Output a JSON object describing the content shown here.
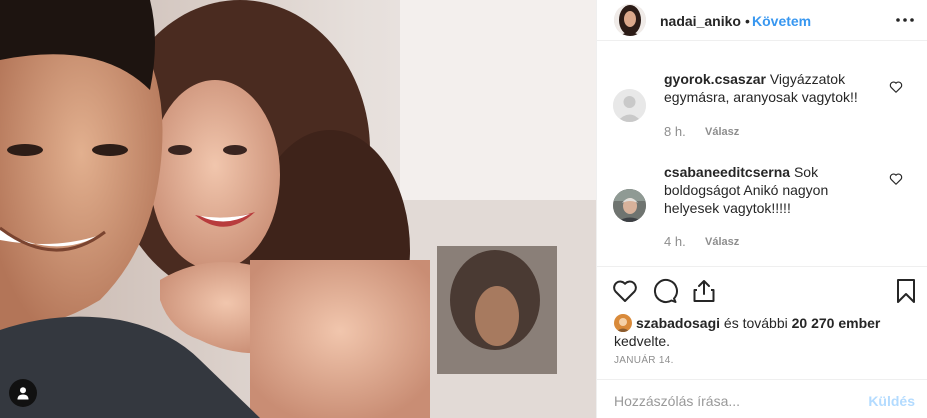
{
  "post": {
    "author": "nadai_aniko",
    "separator": "•",
    "follow_label": "Követem",
    "more_icon": "more-options-icon"
  },
  "comments": [
    {
      "user": "gyorok.csaszar",
      "text": " Vigyázzatok egymásra, aranyosak vagytok!!",
      "time": "8 h.",
      "reply_label": "Válasz"
    },
    {
      "user": "csabaneeditcserna",
      "text": " Sok boldogságot Anikó nagyon helyesek vagytok!!!!!",
      "time": "4 h.",
      "reply_label": "Válasz"
    }
  ],
  "likes": {
    "user": "szabadosagi",
    "middle_text": " és további ",
    "count": "20 270 ember",
    "suffix": " kedvelte."
  },
  "date": "JANUÁR 14.",
  "comment_box": {
    "placeholder": "Hozzászólás írása...",
    "send_label": "Küldés"
  },
  "colors": {
    "accent": "#3897f0",
    "send_disabled": "#b3dbff",
    "muted": "#8e8e8e",
    "text": "#262626"
  }
}
